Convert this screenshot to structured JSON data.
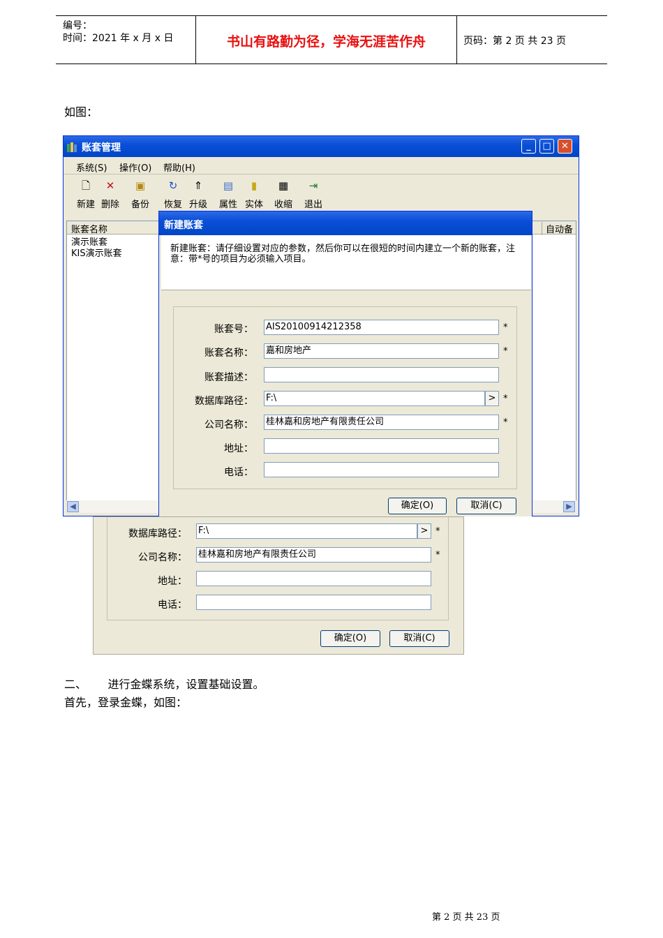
{
  "header": {
    "number_label": "编号：",
    "time_label": "时间：2021 年 x 月 x 日",
    "slogan": "书山有路勤为径，学海无涯苦作舟",
    "page_label": "页码：第 2 页  共 23 页"
  },
  "intro_text": "如图：",
  "window": {
    "title": "账套管理",
    "menu": [
      "系统(S)",
      "操作(O)",
      "帮助(H)"
    ],
    "toolbar": [
      "新建",
      "删除",
      "备份",
      "恢复",
      "升级",
      "属性",
      "实体",
      "收缩",
      "退出"
    ],
    "list_header": "账套名称",
    "list_header_right": "自动备",
    "accounts": [
      "演示账套",
      "KIS演示账套"
    ]
  },
  "dialog": {
    "title": "新建账套",
    "instruction": "新建账套：请仔细设置对应的参数，然后你可以在很短的时间内建立一个新的账套，注意：带*号的项目为必须输入项目。",
    "fields": [
      {
        "label": "账套号：",
        "value": "AIS20100914212358",
        "required": "*"
      },
      {
        "label": "账套名称：",
        "value": "嘉和房地产",
        "required": "*"
      },
      {
        "label": "账套描述：",
        "value": "",
        "required": ""
      },
      {
        "label": "数据库路径：",
        "value": "F:\\",
        "required": "*"
      },
      {
        "label": "公司名称：",
        "value": "桂林嘉和房地产有限责任公司",
        "required": "*"
      },
      {
        "label": "地址：",
        "value": "",
        "required": ""
      },
      {
        "label": "电话：",
        "value": "",
        "required": ""
      }
    ],
    "browse_label": ">",
    "ok_label": "确定(O)",
    "cancel_label": "取消(C)"
  },
  "second_shot": {
    "fields": [
      {
        "label": "数据库路径：",
        "value": "F:\\",
        "required": "*"
      },
      {
        "label": "公司名称：",
        "value": "桂林嘉和房地产有限责任公司",
        "required": "*"
      },
      {
        "label": "地址：",
        "value": "",
        "required": ""
      },
      {
        "label": "电话：",
        "value": "",
        "required": ""
      }
    ],
    "browse_label": ">",
    "ok_label": "确定(O)",
    "cancel_label": "取消(C)"
  },
  "section_two": "二、      进行金蝶系统，设置基础设置。",
  "login_text": "首先，登录金蝶，如图：",
  "footer": "第 2 页 共 23 页"
}
